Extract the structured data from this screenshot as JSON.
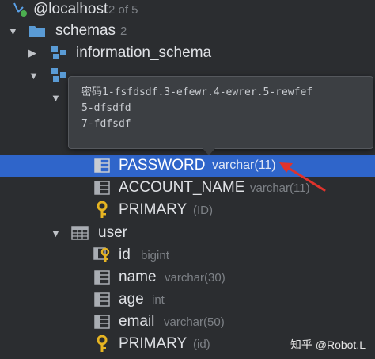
{
  "connection": {
    "name": "@localhost",
    "count": "2 of 5"
  },
  "schemas_node": {
    "label": "schemas",
    "count": "2"
  },
  "schema_information": {
    "label": "information_schema"
  },
  "schema_second": {
    "label": ""
  },
  "tooltip": {
    "lines": [
      "密码1-fsfdsdf.3-efewr.4-ewrer.5-rewfef",
      "5-dfsdfd",
      "7-fdfsdf"
    ]
  },
  "account_table": {
    "columns": [
      {
        "name": "PASSWORD",
        "type": "varchar(11)",
        "icon": "column-icon",
        "selected": true
      },
      {
        "name": "ACCOUNT_NAME",
        "type": "varchar(11)",
        "icon": "column-icon",
        "selected": false
      }
    ],
    "key": {
      "name": "PRIMARY",
      "type": "(ID)",
      "icon": "key-icon"
    }
  },
  "user_table": {
    "label": "user",
    "columns": [
      {
        "name": "id",
        "type": "bigint",
        "icon": "primary-key-column-icon"
      },
      {
        "name": "name",
        "type": "varchar(30)",
        "icon": "column-icon"
      },
      {
        "name": "age",
        "type": "int",
        "icon": "column-icon"
      },
      {
        "name": "email",
        "type": "varchar(50)",
        "icon": "column-icon"
      }
    ],
    "key": {
      "name": "PRIMARY",
      "type": "(id)",
      "icon": "key-icon"
    }
  },
  "watermark": "知乎 @Robot.L",
  "colors": {
    "background": "#2b2d30",
    "selection": "#2f65ca",
    "arrow_annotation": "#e0332c",
    "folder_icon": "#5a9bd5",
    "key_icon": "#e6b422"
  }
}
